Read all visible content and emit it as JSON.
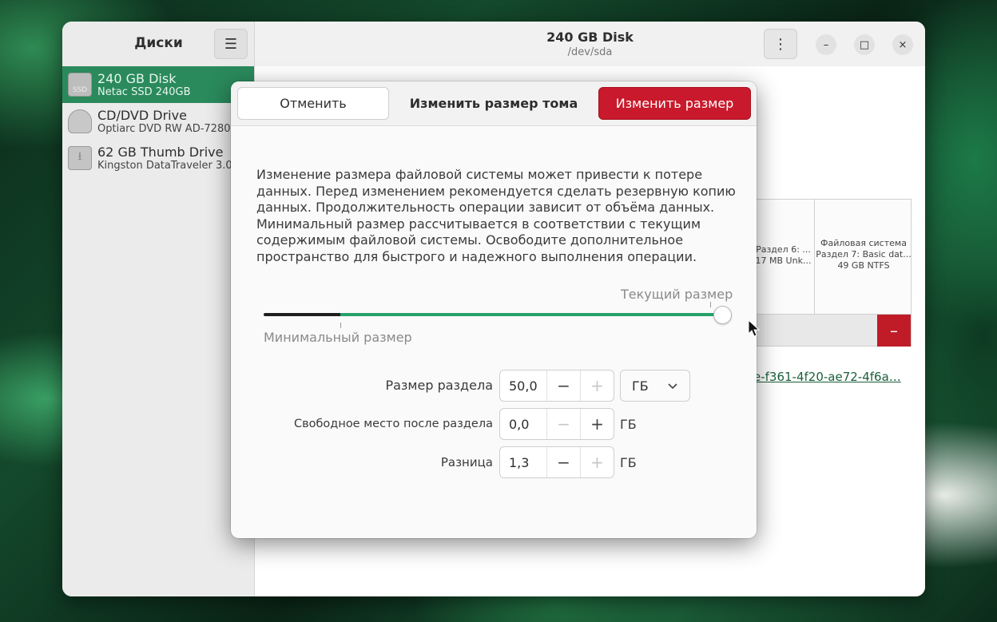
{
  "sidebar": {
    "title": "Диски",
    "drives": [
      {
        "name": "240 GB Disk",
        "desc": "Netac SSD 240GB",
        "icon_label": "SSD",
        "icon": "ssd-icon"
      },
      {
        "name": "CD/DVD Drive",
        "desc": "Optiarc DVD RW AD-7280",
        "icon": "optical-disc-icon"
      },
      {
        "name": "62 GB Thumb Drive",
        "desc": "Kingston DataTraveler 3.0",
        "icon": "usb-icon"
      }
    ]
  },
  "header": {
    "title": "240 GB Disk",
    "subtitle": "/dev/sda"
  },
  "window_controls": {
    "minimize": "–",
    "maximize": "□",
    "close": "×"
  },
  "partitions": [
    {
      "line1": "Раздел 6: ...",
      "line2": "17 MB Unk..."
    },
    {
      "line1": "Файловая система",
      "line2": "Раздел 7: Basic dat...",
      "line3": "49 GB NTFS"
    }
  ],
  "partition_toolbar": {
    "remove_label": "–"
  },
  "uuid_text": "e-f361-4f20-ae72-4f6a…",
  "dialog": {
    "cancel_label": "Отменить",
    "title": "Изменить размер тома",
    "resize_label": "Изменить размер",
    "description": "Изменение размера файловой системы может привести к потере данных. Перед изменением рекомендуется сделать резервную копию данных. Продолжительность операции зависит от объёма данных. Минимальный размер рассчитывается в соответствии с текущим содержимым файловой системы. Освободите дополнительное пространство для быстрого и надежного выполнения операции.",
    "slider": {
      "current_label": "Текущий размер",
      "min_label": "Минимальный размер",
      "min_fraction": 0.17,
      "value_fraction": 1.0
    },
    "fields": [
      {
        "label": "Размер раздела",
        "value": "50,0",
        "unit": "ГБ",
        "minus": "−",
        "plus": "+"
      },
      {
        "label": "Свободное место после раздела",
        "value": "0,0",
        "unit": "ГБ",
        "minus": "−",
        "plus": "+"
      },
      {
        "label": "Разница",
        "value": "1,3",
        "unit": "ГБ",
        "minus": "−",
        "plus": "+"
      }
    ]
  },
  "colors": {
    "accent_green": "#26a269",
    "selected_row": "#2a8a5c",
    "destructive_red": "#c81a2c"
  }
}
